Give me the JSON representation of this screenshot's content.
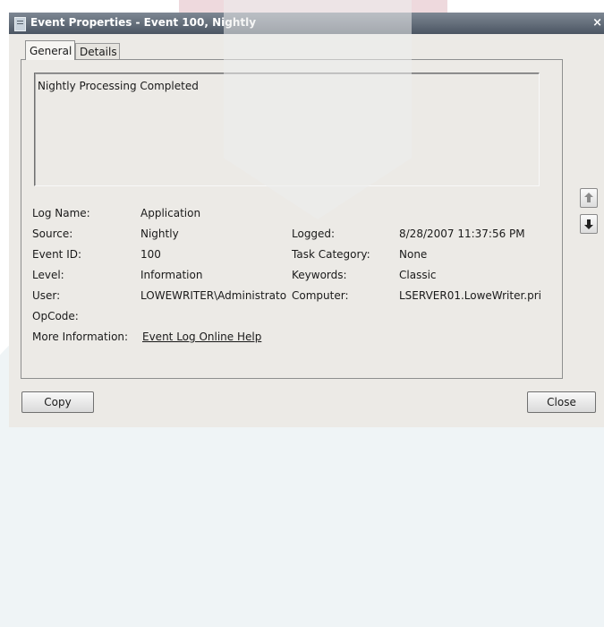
{
  "window": {
    "title": "Event Properties - Event 100, Nightly",
    "close_glyph": "×"
  },
  "tabs": [
    {
      "label": "General",
      "selected": true
    },
    {
      "label": "Details",
      "selected": false
    }
  ],
  "description": "Nightly Processing Completed",
  "fields_left": [
    {
      "label": "Log Name:",
      "value": "Application"
    },
    {
      "label": "Source:",
      "value": "Nightly"
    },
    {
      "label": "Event ID:",
      "value": "100"
    },
    {
      "label": "Level:",
      "value": "Information"
    },
    {
      "label": "User:",
      "value": "LOWEWRITER\\Administrator"
    },
    {
      "label": "OpCode:",
      "value": ""
    },
    {
      "label": "More Information:",
      "value": "Event Log Online Help"
    }
  ],
  "fields_right": [
    {
      "label": "Logged:",
      "value": "8/28/2007 11:37:56 PM"
    },
    {
      "label": "Task Category:",
      "value": "None"
    },
    {
      "label": "Keywords:",
      "value": "Classic"
    },
    {
      "label": "Computer:",
      "value": "LSERVER01.LoweWriter.pri"
    }
  ],
  "buttons": {
    "copy": "Copy",
    "close": "Close",
    "up_icon": "arrow-up-icon",
    "down_icon": "arrow-down-icon"
  }
}
